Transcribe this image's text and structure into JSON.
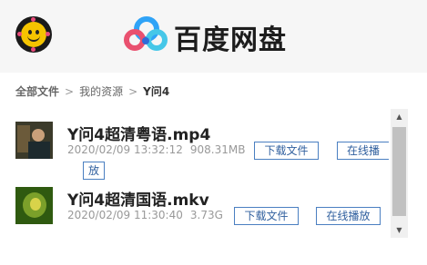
{
  "header": {
    "brand": "百度网盘"
  },
  "breadcrumb": {
    "all_files": "全部文件",
    "sep1": ">",
    "my_resources": "我的资源",
    "sep2": ">",
    "current": "Y问4"
  },
  "files": [
    {
      "name": "Y问4超清粤语.mp4",
      "date": "2020/02/09 13:32:12",
      "size": "908.31MB",
      "download_label": "下载文件",
      "play_label_line1": "在线播",
      "play_label_line2": "放"
    },
    {
      "name": "Y问4超清国语.mkv",
      "date": "2020/02/09 11:30:40",
      "size": "3.73G",
      "download_label": "下载文件",
      "play_label": "在线播放"
    }
  ],
  "scrollbar": {
    "up_glyph": "▲",
    "down_glyph": "▼"
  }
}
